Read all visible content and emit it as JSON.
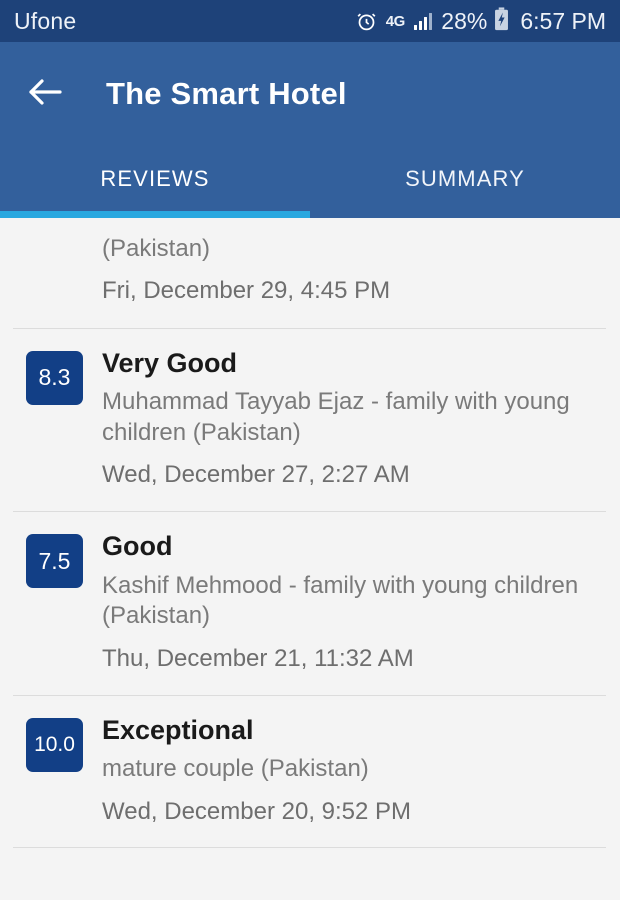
{
  "status_bar": {
    "carrier": "Ufone",
    "network_type": "4G",
    "battery_percent": "28%",
    "clock": "6:57 PM",
    "icons": {
      "alarm": "alarm-icon",
      "signal": "signal-bars-icon",
      "battery": "battery-charging-icon"
    },
    "background": "#1e4279"
  },
  "app_bar": {
    "back_icon": "back-arrow-icon",
    "title": "The Smart Hotel",
    "background": "#33609c"
  },
  "tabs": {
    "items": [
      {
        "label": "REVIEWS",
        "active": true
      },
      {
        "label": "SUMMARY",
        "active": false
      }
    ],
    "indicator_color": "#29a8e0"
  },
  "reviews": {
    "badge_color": "#123f86",
    "items": [
      {
        "score": "",
        "title": "",
        "author": "(Pakistan)",
        "date": "Fri, December 29, 4:45 PM",
        "partial": true
      },
      {
        "score": "8.3",
        "title": "Very Good",
        "author": "Muhammad Tayyab Ejaz - family with young children (Pakistan)",
        "date": "Wed, December 27, 2:27 AM",
        "partial": false
      },
      {
        "score": "7.5",
        "title": "Good",
        "author": "Kashif Mehmood - family with young children (Pakistan)",
        "date": "Thu, December 21, 11:32 AM",
        "partial": false
      },
      {
        "score": "10.0",
        "title": "Exceptional",
        "author": "mature couple (Pakistan)",
        "date": "Wed, December 20, 9:52 PM",
        "partial": false
      }
    ]
  }
}
